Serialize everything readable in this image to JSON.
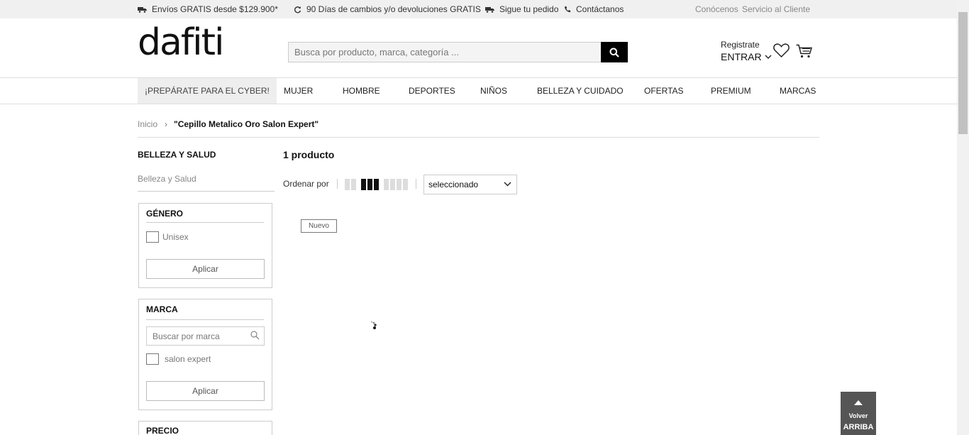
{
  "topbar": {
    "shipping": "Envíos GRATIS desde $129.900*",
    "returns": "90 Días de cambios y/o devoluciones GRATIS",
    "tracking": "Sigue tu pedido",
    "contact": "Contáctanos",
    "about": "Conócenos",
    "service": "Servicio al Cliente"
  },
  "header": {
    "logo": "dafiti",
    "search_placeholder": "Busca por producto, marca, categoría ...",
    "register": "Registrate",
    "login": "ENTRAR"
  },
  "nav": {
    "promo": "¡PREPÁRATE PARA EL CYBER!",
    "items": [
      "MUJER",
      "HOMBRE",
      "DEPORTES",
      "NIÑOS",
      "BELLEZA Y CUIDADO",
      "OFERTAS",
      "PREMIUM",
      "MARCAS"
    ]
  },
  "breadcrumb": {
    "home": "Inicio",
    "separator": "›",
    "current": "\"Cepillo Metalico Oro Salon Expert\""
  },
  "sidebar": {
    "title": "BELLEZA Y SALUD",
    "category": "Belleza y Salud",
    "gender": {
      "title": "GÉNERO",
      "option": "Unisex",
      "apply": "Aplicar"
    },
    "brand": {
      "title": "MARCA",
      "search_placeholder": "Buscar por marca",
      "option": "salon expert",
      "apply": "Aplicar"
    },
    "price": {
      "title": "PRECIO"
    }
  },
  "main": {
    "count": "1 producto",
    "sort_label": "Ordenar por",
    "sort_value": "seleccionado",
    "badge": "Nuevo"
  },
  "back_to_top": {
    "small": "Volver",
    "large": "ARRIBA"
  }
}
